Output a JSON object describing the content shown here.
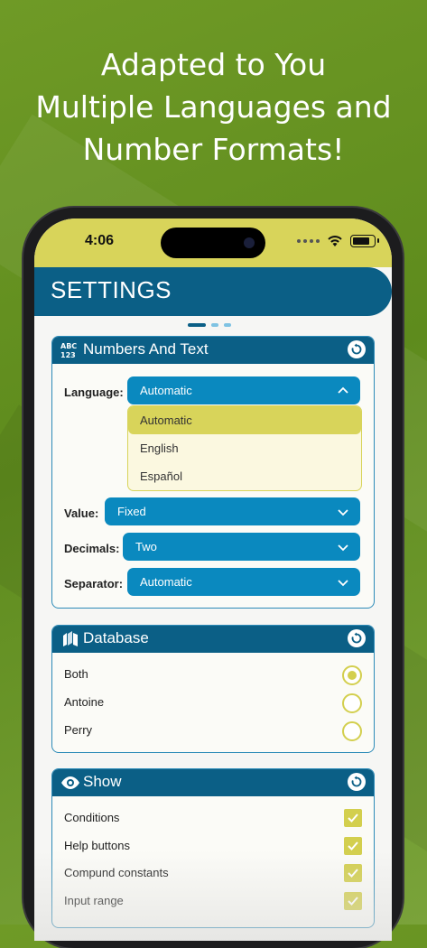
{
  "headline": [
    "Adapted to You",
    "Multiple Languages and",
    "Number Formats!"
  ],
  "status": {
    "time": "4:06"
  },
  "header": {
    "title": "SETTINGS"
  },
  "pager": {
    "count": 3,
    "active": 0
  },
  "numbers_card": {
    "icon_text": "ABC 123",
    "title": "Numbers And Text",
    "language": {
      "label": "Language:",
      "value": "Automatic",
      "options": [
        "Automatic",
        "English",
        "Español"
      ],
      "selected": "Automatic"
    },
    "value": {
      "label": "Value:",
      "value": "Fixed"
    },
    "decimals": {
      "label": "Decimals:",
      "value": "Two"
    },
    "separator": {
      "label": "Separator:",
      "value": "Automatic"
    }
  },
  "database_card": {
    "title": "Database",
    "items": [
      {
        "label": "Both",
        "selected": true
      },
      {
        "label": "Antoine",
        "selected": false
      },
      {
        "label": "Perry",
        "selected": false
      }
    ]
  },
  "show_card": {
    "title": "Show",
    "items": [
      {
        "label": "Conditions",
        "checked": true
      },
      {
        "label": "Help buttons",
        "checked": true
      },
      {
        "label": "Compund constants",
        "checked": true
      },
      {
        "label": "Input range",
        "checked": true
      }
    ]
  },
  "colors": {
    "header": "#0b5f86",
    "accent": "#d8d45a",
    "select": "#0a89bf"
  }
}
